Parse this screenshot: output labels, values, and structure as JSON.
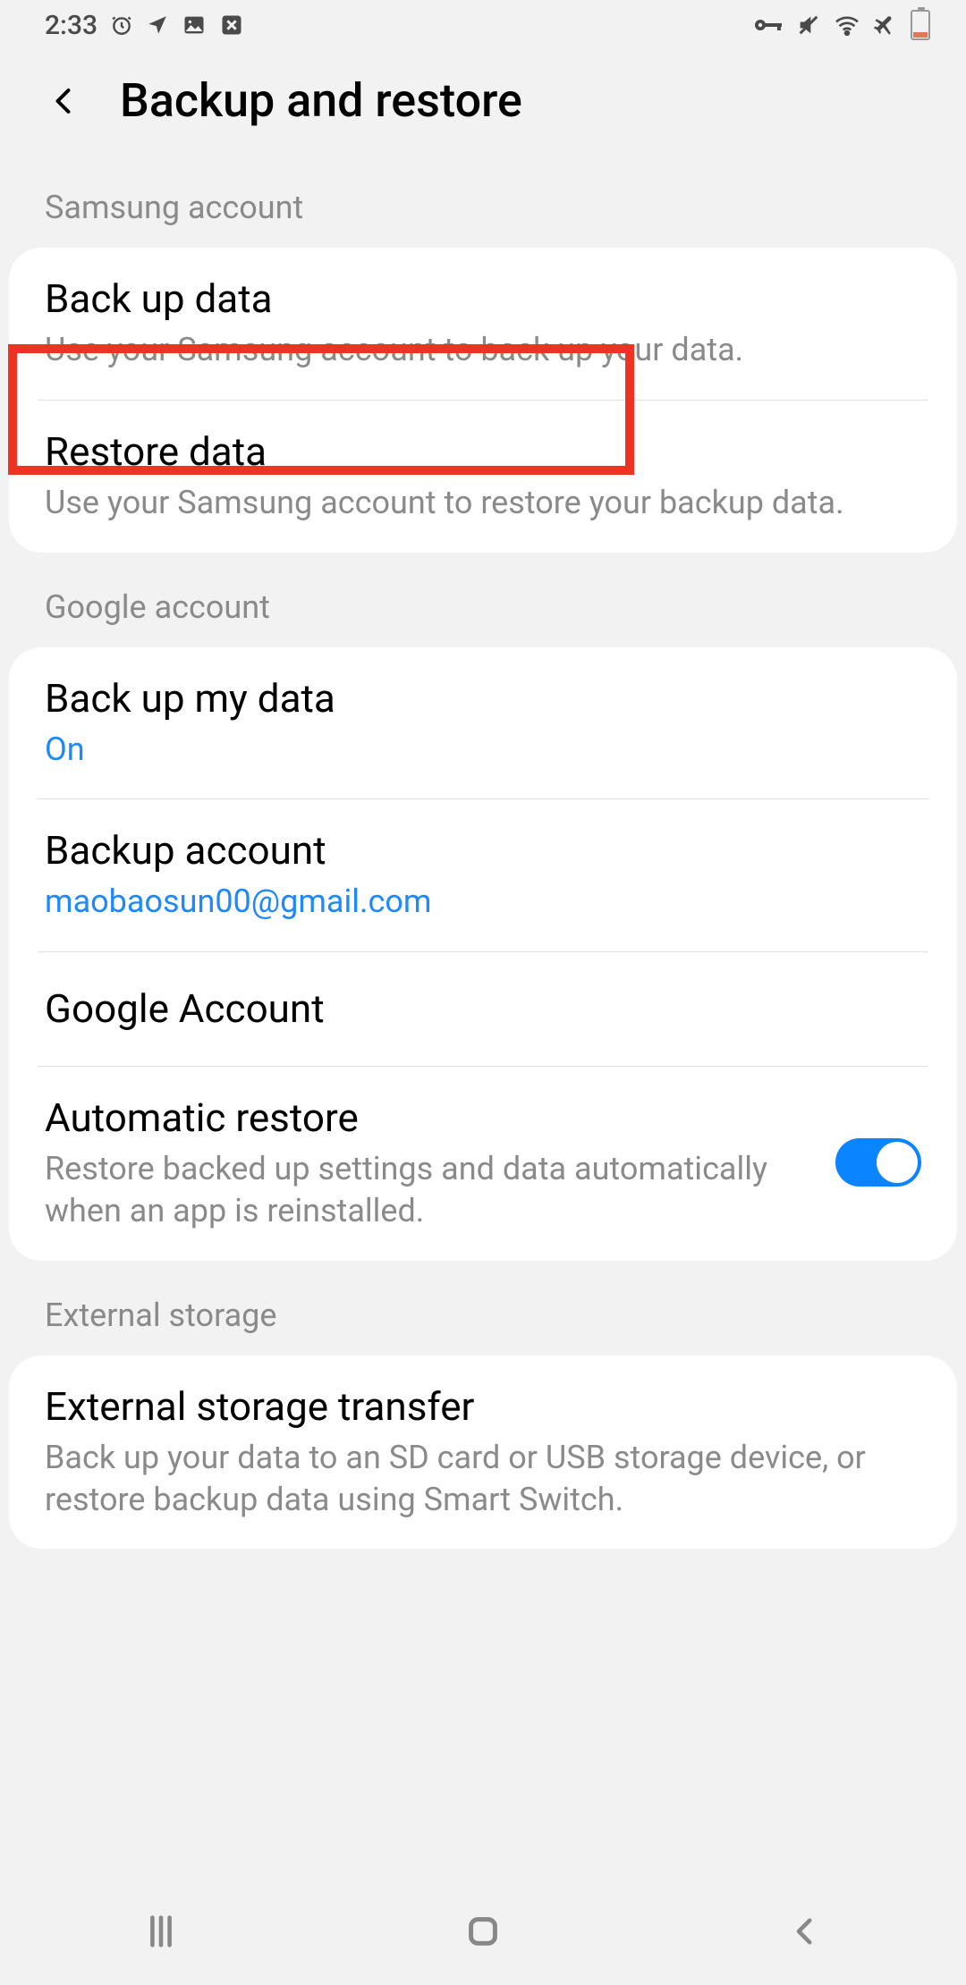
{
  "status": {
    "time": "2:33",
    "icons_left": [
      "alarm",
      "location",
      "image",
      "x-box"
    ],
    "icons_right": [
      "vpn-key",
      "mute",
      "wifi",
      "airplane",
      "battery"
    ]
  },
  "header": {
    "title": "Backup and restore"
  },
  "sections": [
    {
      "header": "Samsung account",
      "items": [
        {
          "title": "Back up data",
          "sub": "Use your Samsung account to back up your data."
        },
        {
          "title": "Restore data",
          "sub": "Use your Samsung account to restore your backup data.",
          "highlighted": true
        }
      ]
    },
    {
      "header": "Google account",
      "items": [
        {
          "title": "Back up my data",
          "sub_blue": "On"
        },
        {
          "title": "Backup account",
          "sub_blue": "maobaosun00@gmail.com"
        },
        {
          "title": "Google Account"
        },
        {
          "title": "Automatic restore",
          "sub": "Restore backed up settings and data automatically when an app is reinstalled.",
          "toggle": true,
          "toggle_on": true
        }
      ]
    },
    {
      "header": "External storage",
      "items": [
        {
          "title": "External storage transfer",
          "sub": "Back up your data to an SD card or USB storage device, or restore backup data using Smart Switch."
        }
      ]
    }
  ]
}
